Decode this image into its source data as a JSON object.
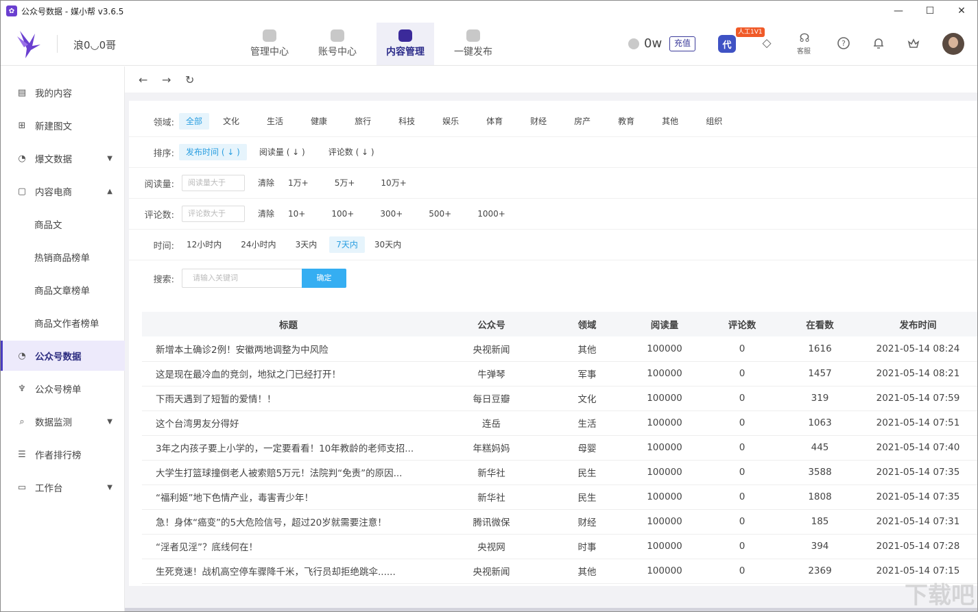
{
  "window": {
    "title": "公众号数据 - 媒小帮 v3.6.5",
    "minimize": "—",
    "maximize": "☐",
    "close": "✕"
  },
  "header": {
    "username": "浪0◡0哥",
    "nav": [
      {
        "label": "管理中心",
        "icon": "management-icon"
      },
      {
        "label": "账号中心",
        "icon": "account-icon"
      },
      {
        "label": "内容管理",
        "icon": "content-icon"
      },
      {
        "label": "一键发布",
        "icon": "publish-icon"
      }
    ],
    "active_nav": 2,
    "coins": "0w",
    "recharge": "充值",
    "dai_badge": "代",
    "ai_badge": "人工1V1",
    "kefu": "客服",
    "accent": "#3b2a9a"
  },
  "sidebar": {
    "items": [
      {
        "label": "我的内容",
        "icon": "document-icon"
      },
      {
        "label": "新建图文",
        "icon": "new-article-icon"
      },
      {
        "label": "爆文数据",
        "icon": "fire-icon"
      },
      {
        "label": "内容电商",
        "icon": "shop-icon"
      },
      {
        "label": "商品文"
      },
      {
        "label": "热销商品榜单"
      },
      {
        "label": "商品文章榜单"
      },
      {
        "label": "商品文作者榜单"
      },
      {
        "label": "公众号数据",
        "icon": "pie-chart-icon"
      },
      {
        "label": "公众号榜单",
        "icon": "trophy-icon"
      },
      {
        "label": "数据监测",
        "icon": "monitor-search-icon"
      },
      {
        "label": "作者排行榜",
        "icon": "author-icon"
      },
      {
        "label": "工作台",
        "icon": "desktop-icon"
      }
    ]
  },
  "filters": {
    "domain_label": "领域:",
    "domains": [
      "全部",
      "文化",
      "生活",
      "健康",
      "旅行",
      "科技",
      "娱乐",
      "体育",
      "财经",
      "房产",
      "教育",
      "其他",
      "组织"
    ],
    "sort_label": "排序:",
    "sorts": [
      "发布时间 ( ↓ )",
      "阅读量 ( ↓ )",
      "评论数 ( ↓ )"
    ],
    "reads_label": "阅读量:",
    "reads_placeholder": "阅读量大于",
    "reads_clear": "清除",
    "reads_opts": [
      "1万+",
      "5万+",
      "10万+"
    ],
    "comments_label": "评论数:",
    "comments_placeholder": "评论数大于",
    "comments_clear": "清除",
    "comments_opts": [
      "10+",
      "100+",
      "300+",
      "500+",
      "1000+"
    ],
    "time_label": "时间:",
    "times": [
      "12小时内",
      "24小时内",
      "3天内",
      "7天内",
      "30天内"
    ],
    "search_label": "搜索:",
    "search_placeholder": "请输入关键词",
    "search_button": "确定"
  },
  "table": {
    "headers": [
      "标题",
      "公众号",
      "领域",
      "阅读量",
      "评论数",
      "在看数",
      "发布时间"
    ],
    "rows": [
      [
        "新增本土确诊2例！安徽两地调整为中风险",
        "央视新闻",
        "其他",
        "100000",
        "0",
        "1616",
        "2021-05-14 08:24"
      ],
      [
        "这是现在最冷血的竞剑，地狱之门已经打开！",
        "牛弹琴",
        "军事",
        "100000",
        "0",
        "1457",
        "2021-05-14 08:21"
      ],
      [
        "下雨天遇到了短暂的爱情！！",
        "每日豆瓣",
        "文化",
        "100000",
        "0",
        "319",
        "2021-05-14 07:59"
      ],
      [
        "这个台湾男友分得好",
        "连岳",
        "生活",
        "100000",
        "0",
        "1063",
        "2021-05-14 07:51"
      ],
      [
        "3年之内孩子要上小学的，一定要看看！10年教龄的老师支招...",
        "年糕妈妈",
        "母婴",
        "100000",
        "0",
        "445",
        "2021-05-14 07:40"
      ],
      [
        "大学生打篮球撞倒老人被索赔5万元！法院判“免责”的原因...",
        "新华社",
        "民生",
        "100000",
        "0",
        "3588",
        "2021-05-14 07:35"
      ],
      [
        "“福利姬”地下色情产业，毒害青少年！",
        "新华社",
        "民生",
        "100000",
        "0",
        "1808",
        "2021-05-14 07:35"
      ],
      [
        "急！身体“癌变”的5大危险信号，超过20岁就需要注意！",
        "腾讯微保",
        "财经",
        "100000",
        "0",
        "185",
        "2021-05-14 07:31"
      ],
      [
        "“淫者见淫”？底线何在！",
        "央视网",
        "时事",
        "100000",
        "0",
        "394",
        "2021-05-14 07:28"
      ],
      [
        "生死竞速！战机高空停车骤降千米，飞行员却拒绝跳伞......",
        "央视新闻",
        "其他",
        "100000",
        "0",
        "2369",
        "2021-05-14 07:15"
      ]
    ]
  },
  "watermark": "下载吧"
}
